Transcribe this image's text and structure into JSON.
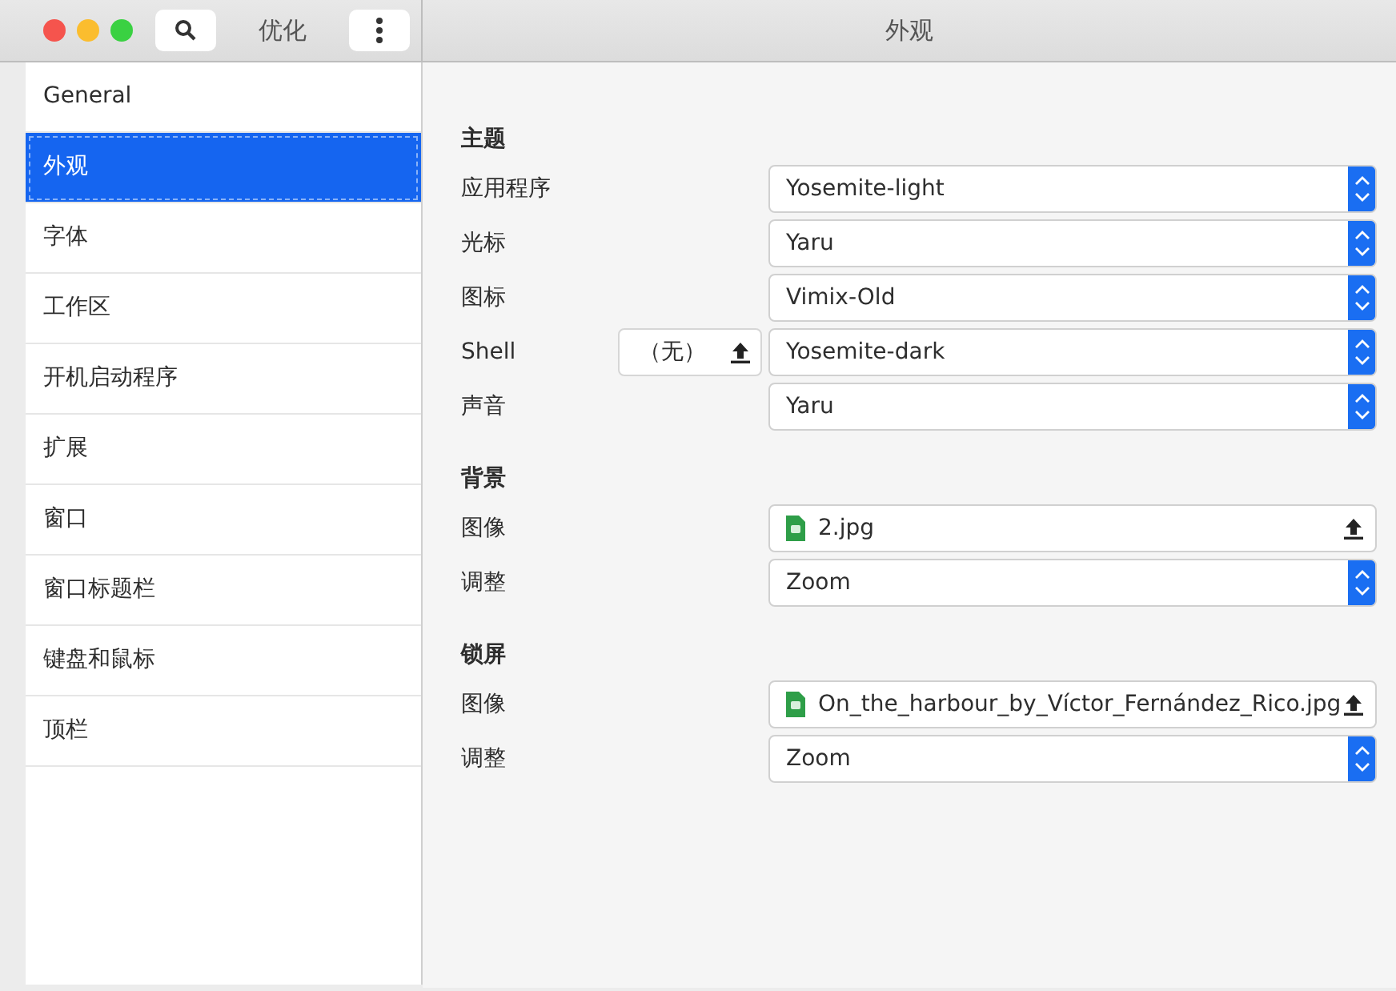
{
  "header": {
    "app_title": "优化",
    "page_title": "外观"
  },
  "sidebar": {
    "items": [
      {
        "label": "General",
        "selected": false
      },
      {
        "label": "外观",
        "selected": true
      },
      {
        "label": "字体",
        "selected": false
      },
      {
        "label": "工作区",
        "selected": false
      },
      {
        "label": "开机启动程序",
        "selected": false
      },
      {
        "label": "扩展",
        "selected": false
      },
      {
        "label": "窗口",
        "selected": false
      },
      {
        "label": "窗口标题栏",
        "selected": false
      },
      {
        "label": "键盘和鼠标",
        "selected": false
      },
      {
        "label": "顶栏",
        "selected": false
      }
    ]
  },
  "sections": [
    {
      "title": "主题",
      "rows": [
        {
          "label": "应用程序",
          "kind": "select",
          "value": "Yosemite-light"
        },
        {
          "label": "光标",
          "kind": "select",
          "value": "Yaru"
        },
        {
          "label": "图标",
          "kind": "select",
          "value": "Vimix-Old"
        },
        {
          "label": "Shell",
          "kind": "select",
          "value": "Yosemite-dark",
          "extra_button": "（无）"
        },
        {
          "label": "声音",
          "kind": "select",
          "value": "Yaru"
        }
      ]
    },
    {
      "title": "背景",
      "rows": [
        {
          "label": "图像",
          "kind": "file",
          "value": "2.jpg"
        },
        {
          "label": "调整",
          "kind": "select",
          "value": "Zoom"
        }
      ]
    },
    {
      "title": "锁屏",
      "rows": [
        {
          "label": "图像",
          "kind": "file",
          "value": "On_the_harbour_by_Víctor_Fernández_Rico.jpg"
        },
        {
          "label": "调整",
          "kind": "select",
          "value": "Zoom"
        }
      ]
    }
  ]
}
